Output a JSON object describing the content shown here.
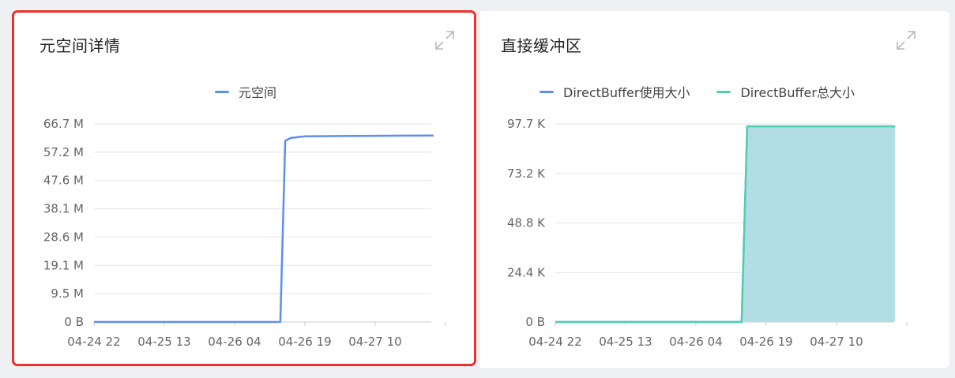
{
  "panels": {
    "left": {
      "title": "元空间详情",
      "expand_icon": "expand-icon",
      "highlighted": true,
      "highlight_color": "#e8322b"
    },
    "right": {
      "title": "直接缓冲区",
      "expand_icon": "expand-icon"
    }
  },
  "chart_data": [
    {
      "type": "line",
      "title": "元空间详情",
      "x_ticks": [
        "04-24 22",
        "04-25 13",
        "04-26 04",
        "04-26 19",
        "04-27 10"
      ],
      "y_ticks": [
        "0 B",
        "9.5 M",
        "19.1 M",
        "28.6 M",
        "38.1 M",
        "47.6 M",
        "57.2 M",
        "66.7 M"
      ],
      "ylim": [
        0,
        66.7
      ],
      "y_unit": "M",
      "grid": true,
      "legend_position": "top-center",
      "series": [
        {
          "name": "元空间",
          "color": "#5b8ff0",
          "points": [
            {
              "x": 0.0,
              "y": 0
            },
            {
              "x": 2.65,
              "y": 0
            },
            {
              "x": 2.72,
              "y": 61.0
            },
            {
              "x": 2.8,
              "y": 62.0
            },
            {
              "x": 3.0,
              "y": 62.5
            },
            {
              "x": 3.5,
              "y": 62.6
            },
            {
              "x": 4.0,
              "y": 62.7
            },
            {
              "x": 4.83,
              "y": 62.8
            }
          ]
        }
      ]
    },
    {
      "type": "area",
      "title": "直接缓冲区",
      "x_ticks": [
        "04-24 22",
        "04-25 13",
        "04-26 04",
        "04-26 19",
        "04-27 10"
      ],
      "y_ticks": [
        "0 B",
        "24.4 K",
        "48.8 K",
        "73.2 K",
        "97.7 K"
      ],
      "ylim": [
        0,
        97.7
      ],
      "y_unit": "K",
      "grid": true,
      "legend_position": "top-center",
      "series": [
        {
          "name": "DirectBuffer使用大小",
          "color": "#5b8ff0",
          "points": [
            {
              "x": 0.0,
              "y": 0
            },
            {
              "x": 2.65,
              "y": 0
            },
            {
              "x": 2.73,
              "y": 96.5
            },
            {
              "x": 4.83,
              "y": 96.5
            }
          ]
        },
        {
          "name": "DirectBuffer总大小",
          "color": "#50cfb0",
          "fill": "#b3dde5",
          "points": [
            {
              "x": 0.0,
              "y": 0
            },
            {
              "x": 2.65,
              "y": 0
            },
            {
              "x": 2.73,
              "y": 96.5
            },
            {
              "x": 4.83,
              "y": 96.5
            }
          ]
        }
      ]
    }
  ]
}
